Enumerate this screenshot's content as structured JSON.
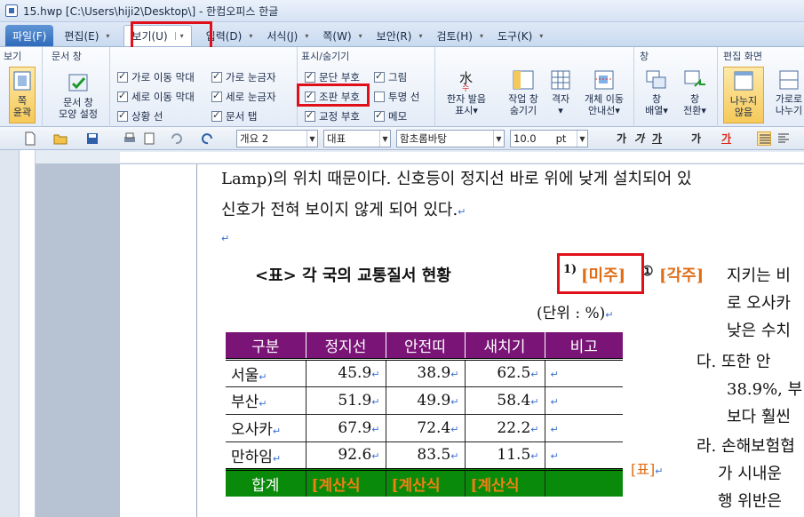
{
  "window": {
    "title": "15.hwp [C:\\Users\\hiji2\\Desktop\\] - 한컴오피스 한글"
  },
  "menu": {
    "items": [
      {
        "label": "파일(F)",
        "caret": "▾"
      },
      {
        "label": "편집(E)",
        "caret": "▾"
      },
      {
        "label": "보기(U)",
        "caret": "▾"
      },
      {
        "label": "입력(D)",
        "caret": "▾"
      },
      {
        "label": "서식(J)",
        "caret": "▾"
      },
      {
        "label": "쪽(W)",
        "caret": "▾"
      },
      {
        "label": "보안(R)",
        "caret": "▾"
      },
      {
        "label": "검토(H)",
        "caret": "▾"
      },
      {
        "label": "도구(K)",
        "caret": "▾"
      }
    ]
  },
  "ribbon": {
    "groups": {
      "view": "보기",
      "docwin": "문서 창",
      "show_hide": "표시/숨기기",
      "window": "창",
      "edit_screen": "편집 화면"
    },
    "buttons": {
      "page_outline": [
        "쪽",
        "윤곽"
      ],
      "docwin_setting": [
        "문서 창",
        "모양 설정"
      ],
      "hanja": [
        "한자 발음",
        "표시▾"
      ],
      "work_window": [
        "작업 창",
        "숨기기"
      ],
      "grid": [
        "격자",
        "▾"
      ],
      "object_move": [
        "개체 이동",
        "안내선▾"
      ],
      "arrange": [
        "창",
        "배열▾"
      ],
      "switch": [
        "창",
        "전환▾"
      ],
      "split": [
        "나누지",
        "않음"
      ],
      "hsplit": [
        "가로로",
        "나누기"
      ]
    },
    "checks": [
      {
        "label": "가로 이동 막대",
        "on": true
      },
      {
        "label": "세로 이동 막대",
        "on": true
      },
      {
        "label": "상황 선",
        "on": true
      },
      {
        "label": "가로 눈금자",
        "on": true
      },
      {
        "label": "세로 눈금자",
        "on": true
      },
      {
        "label": "문서 탭",
        "on": true
      },
      {
        "label": "문단 부호",
        "on": true
      },
      {
        "label": "조판 부호",
        "on": true
      },
      {
        "label": "교정 부호",
        "on": true
      },
      {
        "label": "그림",
        "on": true
      },
      {
        "label": "투명 선",
        "on": false
      },
      {
        "label": "메모",
        "on": true
      }
    ]
  },
  "toolbar": {
    "style": "개요 2",
    "lang": "대표",
    "font": "함초롬바탕",
    "size": "10.0",
    "unit": "pt",
    "fmt": [
      "가",
      "가",
      "가",
      "가",
      "가"
    ]
  },
  "document": {
    "line1": "Lamp)의 위치 때문이다. 신호등이 정지선 바로 위에 낮게 설치되어 있",
    "line2": "신호가 전혀 보이지 않게 되어 있다.",
    "return_mark": "↵",
    "caption_title": "<표> 각 국의 교통질서 현황",
    "endnote_mark": "1)",
    "endnote_code": "[미주]",
    "footnote_mark": "①",
    "footnote_code": "[각주]",
    "unit_note": "(단위 : %)",
    "table_code": "[표]",
    "right_col": [
      "지키는 비",
      "로 오사카",
      "낮은 수치",
      "다. 또한 안",
      "38.9%, 부",
      "보다 훨씬",
      "라. 손해보험협",
      "가 시내운",
      "행 위반은"
    ],
    "table": {
      "headers": [
        "구분",
        "정지선",
        "안전띠",
        "새치기",
        "비고"
      ],
      "rows": [
        [
          "서울",
          "45.9",
          "38.9",
          "62.5",
          ""
        ],
        [
          "부산",
          "51.9",
          "49.9",
          "58.4",
          ""
        ],
        [
          "오사카",
          "67.9",
          "72.4",
          "22.2",
          ""
        ],
        [
          "만하임",
          "92.6",
          "83.5",
          "11.5",
          ""
        ]
      ],
      "sum_label": "합계",
      "calc": "[계산식"
    }
  }
}
